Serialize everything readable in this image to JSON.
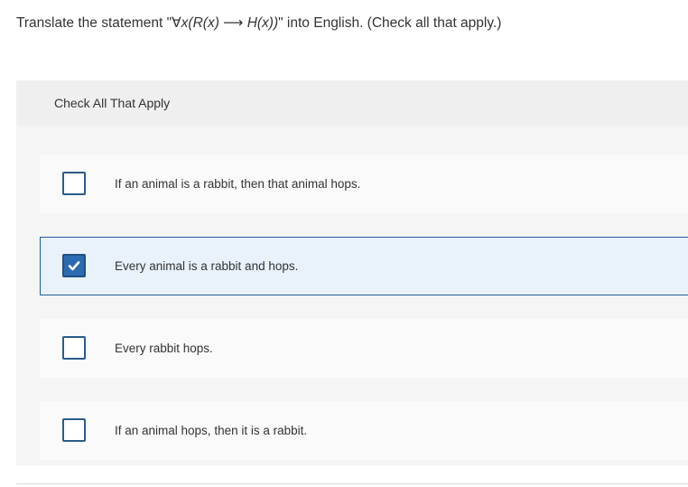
{
  "question": {
    "prefix": "Translate the statement \"",
    "formula": "∀x(R(x) ⟶ H(x))",
    "suffix": "\" into English. (Check all that apply.)"
  },
  "panel": {
    "header_label": "Check All That Apply"
  },
  "options": [
    {
      "label": "If an animal is a rabbit, then that animal hops.",
      "checked": false
    },
    {
      "label": "Every animal is a rabbit and hops.",
      "checked": true
    },
    {
      "label": "Every rabbit hops.",
      "checked": false
    },
    {
      "label": "If an animal hops, then it is a rabbit.",
      "checked": false
    }
  ],
  "colors": {
    "accent": "#2c6bb2",
    "selected_background": "#e9f2fb",
    "checkbox_border": "#2b5c8a"
  },
  "icons": {
    "check": "checkmark-icon"
  }
}
